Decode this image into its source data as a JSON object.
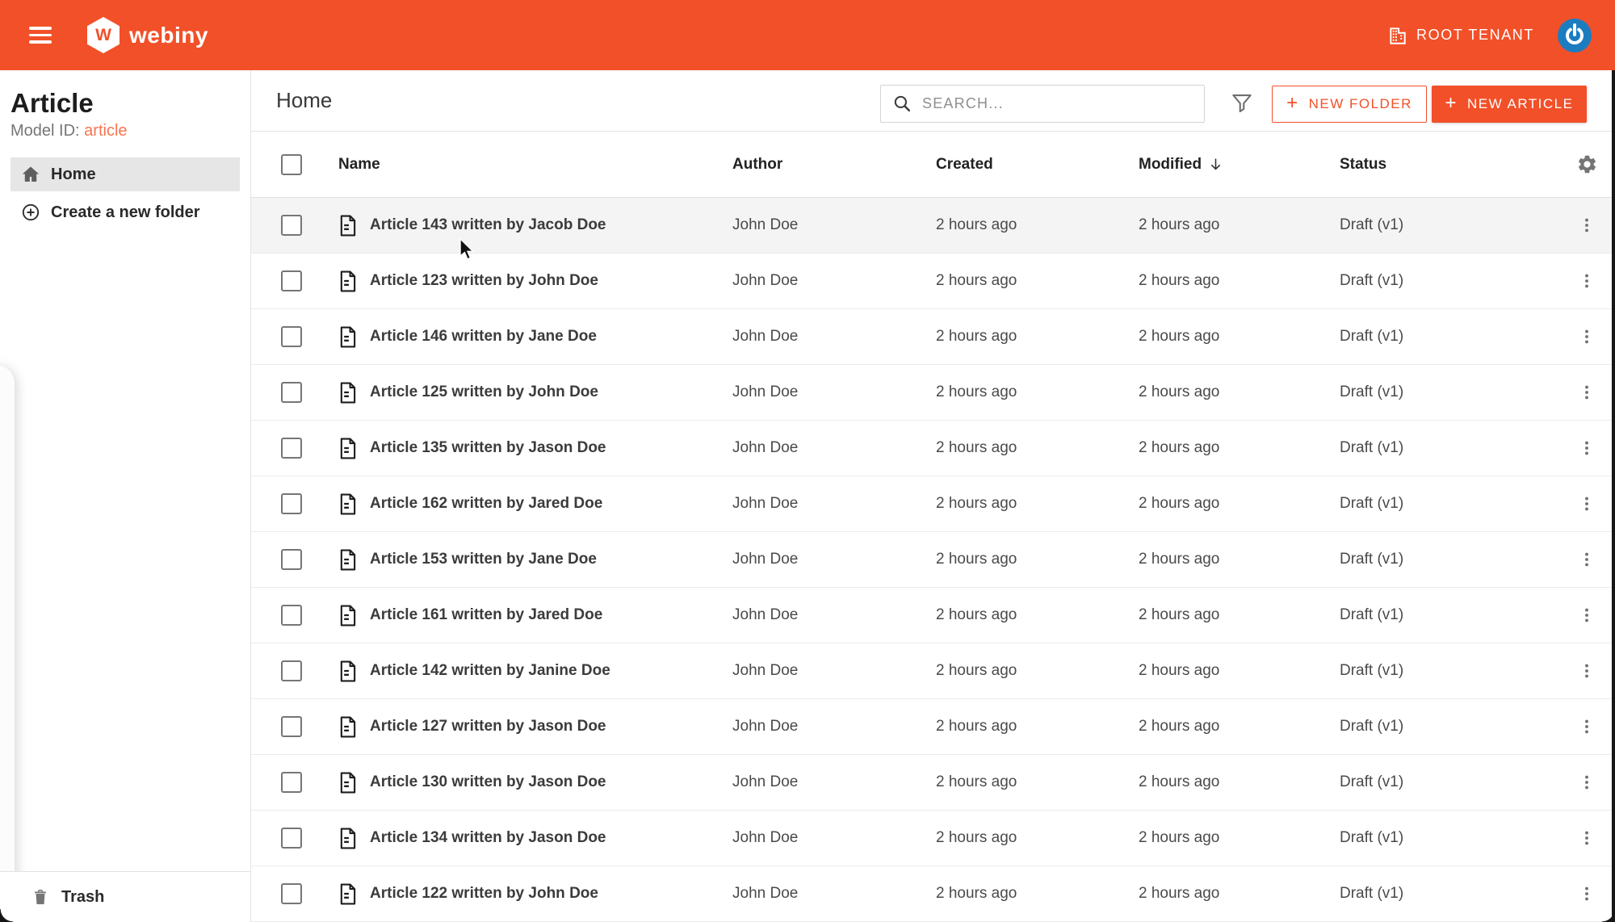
{
  "header": {
    "brand": "webiny",
    "brand_initial": "W",
    "tenant_label": "ROOT TENANT"
  },
  "sidebar": {
    "title": "Article",
    "model_id_label": "Model ID:",
    "model_id_value": "article",
    "home_label": "Home",
    "create_folder_label": "Create a new folder",
    "trash_label": "Trash"
  },
  "toolbar": {
    "breadcrumb": "Home",
    "search_placeholder": "SEARCH...",
    "plus": "+",
    "new_folder_label": "NEW FOLDER",
    "new_article_label": "NEW ARTICLE"
  },
  "table": {
    "columns": [
      "Name",
      "Author",
      "Created",
      "Modified",
      "Status"
    ],
    "sort_column": "Modified",
    "sort_direction": "desc",
    "hovered_row_index": 0,
    "rows": [
      {
        "name": "Article 143 written by Jacob Doe",
        "author": "John Doe",
        "created": "2 hours ago",
        "modified": "2 hours ago",
        "status": "Draft (v1)"
      },
      {
        "name": "Article 123 written by John Doe",
        "author": "John Doe",
        "created": "2 hours ago",
        "modified": "2 hours ago",
        "status": "Draft (v1)"
      },
      {
        "name": "Article 146 written by Jane Doe",
        "author": "John Doe",
        "created": "2 hours ago",
        "modified": "2 hours ago",
        "status": "Draft (v1)"
      },
      {
        "name": "Article 125 written by John Doe",
        "author": "John Doe",
        "created": "2 hours ago",
        "modified": "2 hours ago",
        "status": "Draft (v1)"
      },
      {
        "name": "Article 135 written by Jason Doe",
        "author": "John Doe",
        "created": "2 hours ago",
        "modified": "2 hours ago",
        "status": "Draft (v1)"
      },
      {
        "name": "Article 162 written by Jared Doe",
        "author": "John Doe",
        "created": "2 hours ago",
        "modified": "2 hours ago",
        "status": "Draft (v1)"
      },
      {
        "name": "Article 153 written by Jane Doe",
        "author": "John Doe",
        "created": "2 hours ago",
        "modified": "2 hours ago",
        "status": "Draft (v1)"
      },
      {
        "name": "Article 161 written by Jared Doe",
        "author": "John Doe",
        "created": "2 hours ago",
        "modified": "2 hours ago",
        "status": "Draft (v1)"
      },
      {
        "name": "Article 142 written by Janine Doe",
        "author": "John Doe",
        "created": "2 hours ago",
        "modified": "2 hours ago",
        "status": "Draft (v1)"
      },
      {
        "name": "Article 127 written by Jason Doe",
        "author": "John Doe",
        "created": "2 hours ago",
        "modified": "2 hours ago",
        "status": "Draft (v1)"
      },
      {
        "name": "Article 130 written by Jason Doe",
        "author": "John Doe",
        "created": "2 hours ago",
        "modified": "2 hours ago",
        "status": "Draft (v1)"
      },
      {
        "name": "Article 134 written by Jason Doe",
        "author": "John Doe",
        "created": "2 hours ago",
        "modified": "2 hours ago",
        "status": "Draft (v1)"
      },
      {
        "name": "Article 122 written by John Doe",
        "author": "John Doe",
        "created": "2 hours ago",
        "modified": "2 hours ago",
        "status": "Draft (v1)"
      }
    ]
  },
  "colors": {
    "primary": "#f25028",
    "model_id_accent": "#f4764f",
    "avatar_blue": "#1c7cc0",
    "selected_item_bg": "#e6e6e6"
  }
}
